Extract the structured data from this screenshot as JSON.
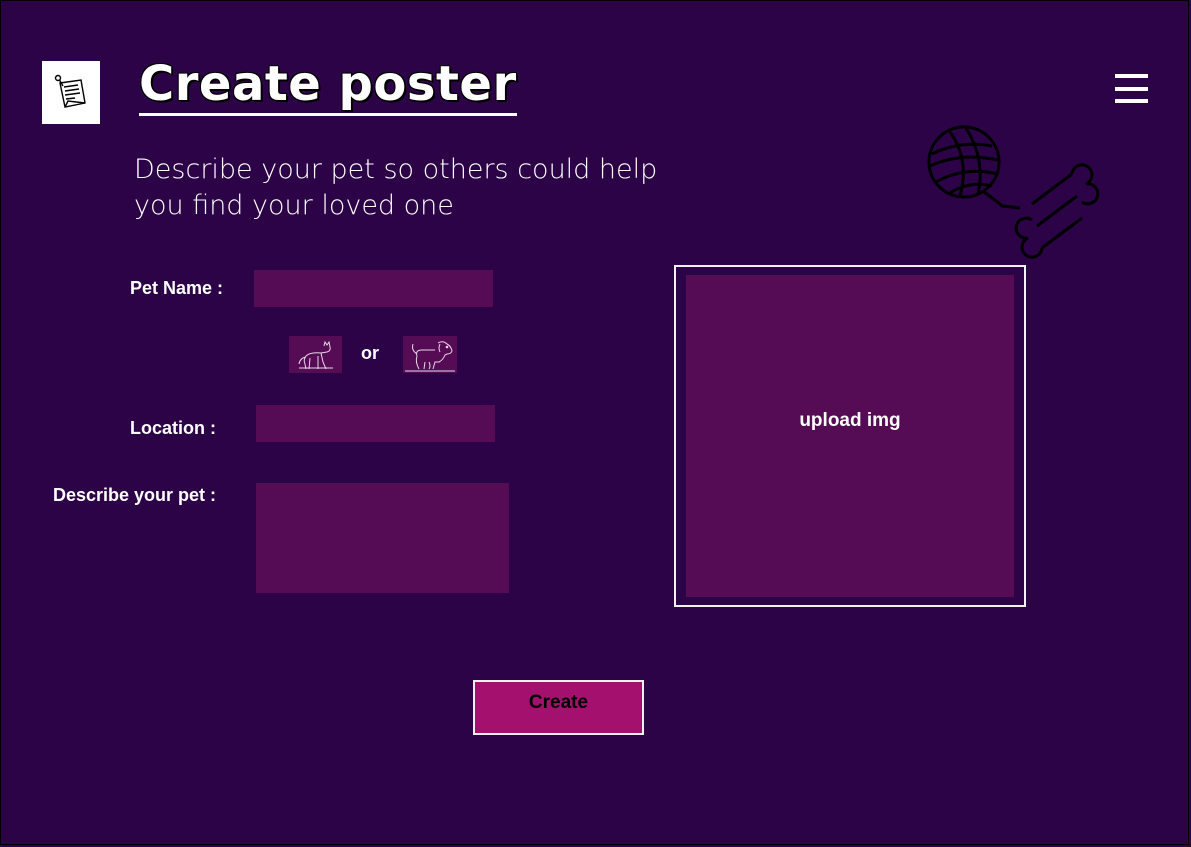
{
  "header": {
    "title": "Create poster",
    "subtitle": "Describe your pet so others could help you find your loved one"
  },
  "icons": {
    "logo": "notes-pin-icon",
    "menu": "hamburger-menu-icon",
    "yarn": "yarn-ball-icon",
    "bone": "bone-icon",
    "cat": "cat-icon",
    "dog": "dog-icon"
  },
  "form": {
    "pet_name_label": "Pet Name :",
    "pet_name_value": "",
    "or_label": "or",
    "location_label": "Location :",
    "location_value": "",
    "description_label": "Describe your pet :",
    "description_value": ""
  },
  "upload": {
    "label": "upload img"
  },
  "actions": {
    "create_label": "Create"
  },
  "colors": {
    "background": "#2c0346",
    "field": "#560b55",
    "button": "#a3106e",
    "text": "#ffffff"
  }
}
